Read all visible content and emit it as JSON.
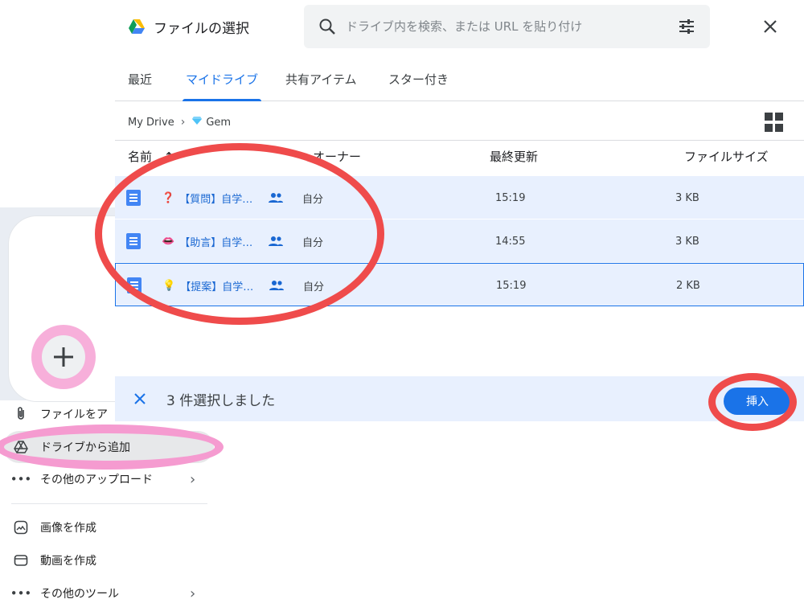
{
  "dialog": {
    "title": "ファイルの選択",
    "search_placeholder": "ドライブ内を検索、または URL を貼り付け",
    "tabs": [
      {
        "label": "最近",
        "active": false
      },
      {
        "label": "マイドライブ",
        "active": true
      },
      {
        "label": "共有アイテム",
        "active": false
      },
      {
        "label": "スター付き",
        "active": false
      }
    ],
    "breadcrumb": {
      "root": "My Drive",
      "folder": "Gem"
    },
    "columns": {
      "name": "名前",
      "sort_arrow": "↑",
      "owner": "オーナー",
      "modified": "最終更新",
      "size": "ファイルサイズ"
    },
    "files": [
      {
        "emoji": "❓",
        "name": "【質問】自学…",
        "owner": "自分",
        "modified": "15:19",
        "size": "3 KB"
      },
      {
        "emoji": "👄",
        "name": "【助言】自学…",
        "owner": "自分",
        "modified": "14:55",
        "size": "3 KB"
      },
      {
        "emoji": "💡",
        "name": "【提案】自学…",
        "owner": "自分",
        "modified": "15:19",
        "size": "2 KB"
      }
    ],
    "selection_text": "3 件選択しました",
    "insert_label": "挿入"
  },
  "menu": {
    "items": [
      {
        "label": "ファイルをア",
        "icon": "paperclip-icon"
      },
      {
        "label": "ドライブから追加",
        "icon": "drive-icon"
      },
      {
        "label": "その他のアップロード",
        "icon": "more-icon"
      },
      {
        "label": "画像を作成",
        "icon": "image-create-icon"
      },
      {
        "label": "動画を作成",
        "icon": "video-create-icon"
      },
      {
        "label": "その他のツール",
        "icon": "more-icon"
      }
    ]
  },
  "colors": {
    "accent": "#1a73e8",
    "selected_row": "#e8f0fe",
    "annotation_red": "#ef4b4b",
    "annotation_pink": "#f59bd0"
  }
}
